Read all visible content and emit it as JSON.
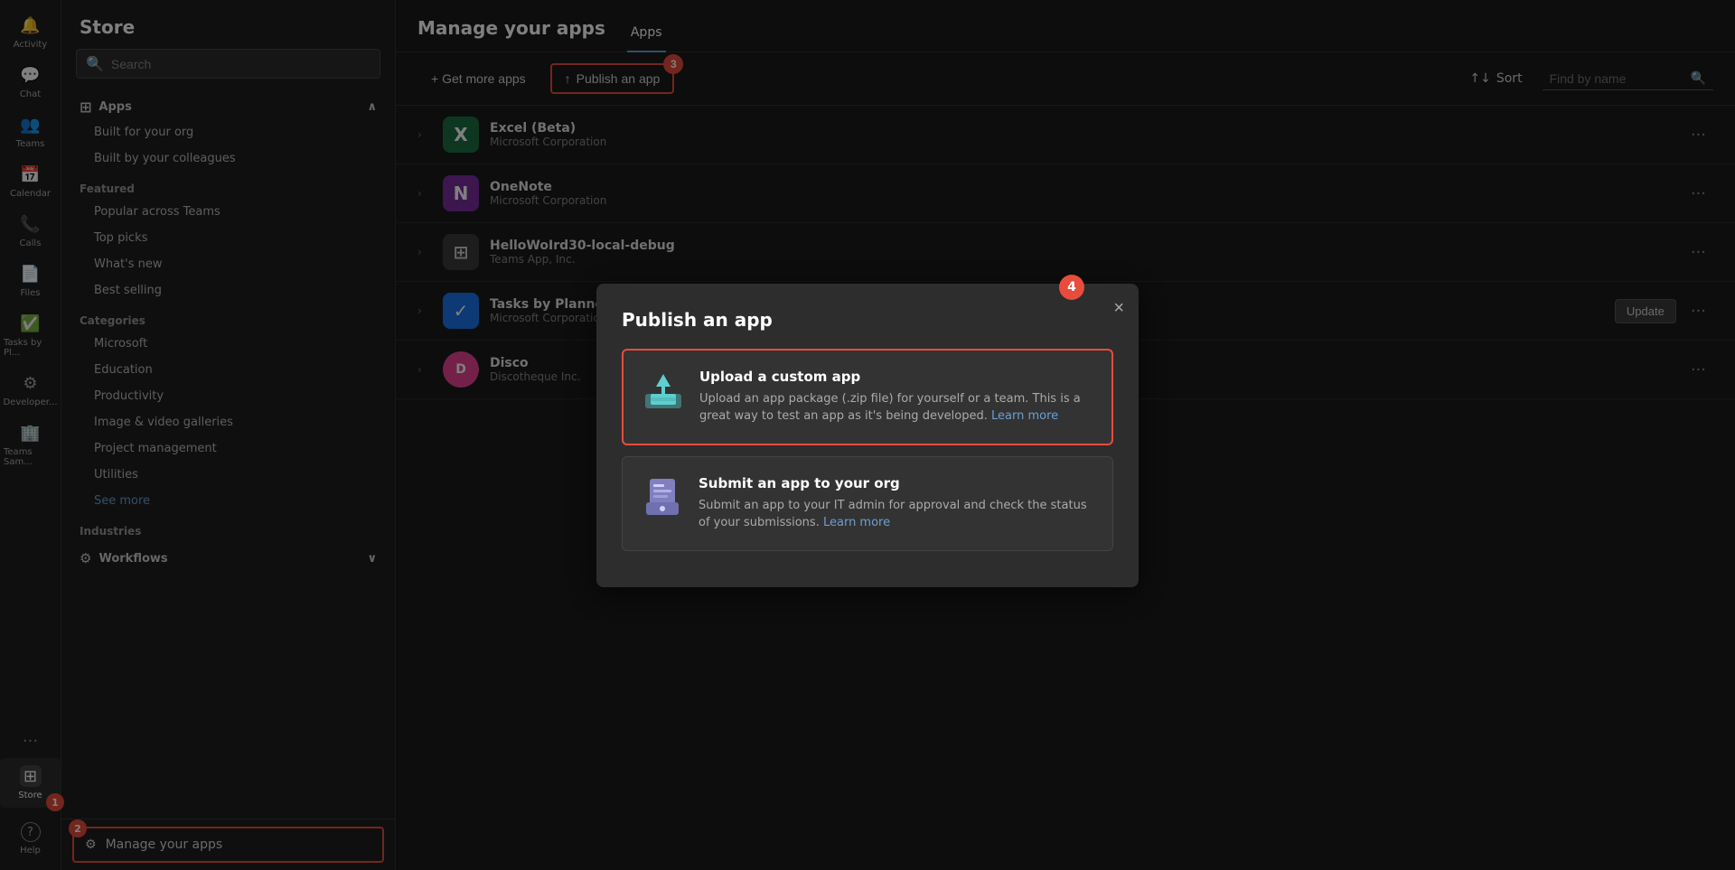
{
  "rail": {
    "items": [
      {
        "id": "activity",
        "label": "Activity",
        "icon": "🔔"
      },
      {
        "id": "chat",
        "label": "Chat",
        "icon": "💬"
      },
      {
        "id": "teams",
        "label": "Teams",
        "icon": "👥"
      },
      {
        "id": "calendar",
        "label": "Calendar",
        "icon": "📅"
      },
      {
        "id": "calls",
        "label": "Calls",
        "icon": "📞"
      },
      {
        "id": "files",
        "label": "Files",
        "icon": "📄"
      },
      {
        "id": "tasks",
        "label": "Tasks by Pl...",
        "icon": "✅"
      },
      {
        "id": "developer",
        "label": "Developer...",
        "icon": "⚙"
      },
      {
        "id": "teams-sam",
        "label": "Teams Sam...",
        "icon": "🏢"
      }
    ],
    "store": {
      "label": "Store",
      "icon": "⊞"
    },
    "more": "...",
    "help": {
      "label": "Help",
      "icon": "?"
    }
  },
  "sidebar": {
    "title": "Store",
    "search": {
      "placeholder": "Search"
    },
    "apps_section": {
      "label": "Apps",
      "items": [
        {
          "label": "Built for your org"
        },
        {
          "label": "Built by your colleagues"
        }
      ]
    },
    "featured_section": {
      "label": "Featured",
      "items": [
        {
          "label": "Popular across Teams"
        },
        {
          "label": "Top picks"
        },
        {
          "label": "What's new"
        },
        {
          "label": "Best selling"
        }
      ]
    },
    "categories_section": {
      "label": "Categories",
      "items": [
        {
          "label": "Microsoft"
        },
        {
          "label": "Education"
        },
        {
          "label": "Productivity"
        },
        {
          "label": "Image & video galleries"
        },
        {
          "label": "Project management"
        },
        {
          "label": "Utilities"
        },
        {
          "label": "See more",
          "type": "see-more"
        }
      ]
    },
    "industries_section": {
      "label": "Industries"
    },
    "workflows_section": {
      "label": "Workflows"
    },
    "manage_apps": {
      "label": "Manage your apps",
      "icon": "⚙"
    },
    "help": {
      "label": "Help",
      "icon": "?"
    }
  },
  "main": {
    "title": "Manage your apps",
    "tabs": [
      {
        "label": "Apps",
        "active": true
      }
    ],
    "toolbar": {
      "get_more": "+ Get more apps",
      "publish": "Publish an app",
      "sort": "↑↓ Sort",
      "find_placeholder": "Find by name"
    },
    "apps": [
      {
        "name": "Excel (Beta)",
        "publisher": "Microsoft Corporation",
        "icon_bg": "#1d6f42",
        "icon_text": "X",
        "icon_color": "#fff"
      },
      {
        "name": "OneNote",
        "publisher": "Microsoft Corporation",
        "icon_bg": "#7B2C9E",
        "icon_text": "N",
        "icon_color": "#fff"
      },
      {
        "name": "HelloWoIrd30-local-debug",
        "publisher": "Teams App, Inc.",
        "icon_bg": "#444",
        "icon_text": "⊞",
        "icon_color": "#ccc"
      },
      {
        "name": "Tasks by Planner and To Do",
        "publisher": "Microsoft Corporation",
        "icon_bg": "#1a73e8",
        "icon_text": "✓",
        "icon_color": "#fff",
        "has_update": true,
        "update_label": "Update"
      },
      {
        "name": "Disco",
        "publisher": "Discotheque Inc.",
        "icon_bg": "#e84393",
        "icon_text": "D",
        "icon_color": "#fff"
      }
    ]
  },
  "modal": {
    "title": "Publish an app",
    "close_label": "×",
    "options": [
      {
        "id": "upload",
        "title": "Upload a custom app",
        "desc": "Upload an app package (.zip file) for yourself or a team. This is a great way to test an app as it's being developed.",
        "learn_more": "Learn more",
        "highlighted": true
      },
      {
        "id": "submit",
        "title": "Submit an app to your org",
        "desc": "Submit an app to your IT admin for approval and check the status of your submissions.",
        "learn_more": "Learn more",
        "highlighted": false
      }
    ]
  },
  "badges": [
    {
      "id": "1",
      "label": "1"
    },
    {
      "id": "2",
      "label": "2"
    },
    {
      "id": "3",
      "label": "3"
    },
    {
      "id": "4",
      "label": "4"
    }
  ],
  "colors": {
    "accent": "#e74c3c",
    "link": "#6b9fd4",
    "active_tab": "#6b9fd4"
  }
}
